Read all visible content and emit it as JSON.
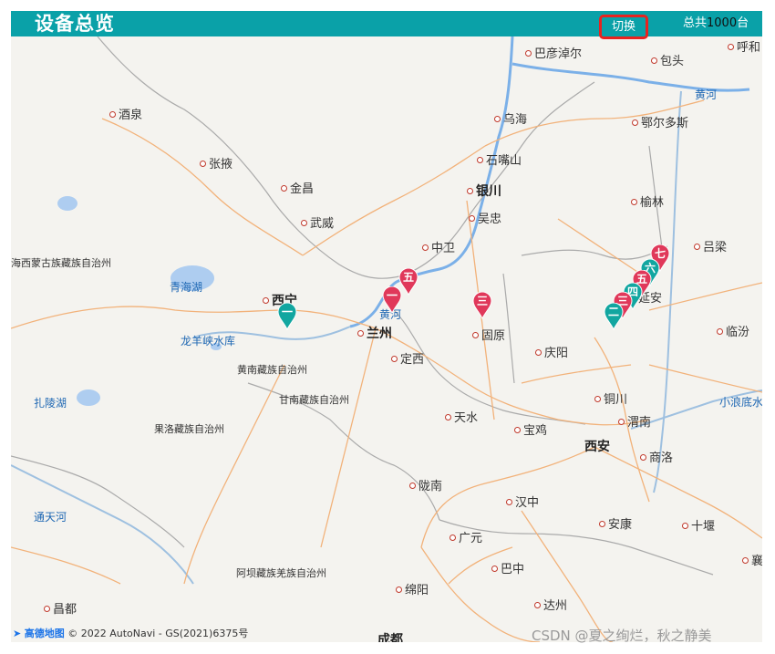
{
  "header": {
    "title": "设备总览",
    "switch_label": "切换",
    "total_prefix": "总共",
    "total_count": "1000",
    "total_suffix": "台"
  },
  "colors": {
    "header_bg": "#0aa1a8",
    "highlight_border": "#e8231f",
    "marker_red": "#e0385a",
    "marker_teal": "#12a6a0"
  },
  "cities": [
    "巴彦淖尔",
    "包头",
    "呼和",
    "酒泉",
    "乌海",
    "鄂尔多斯",
    "张掖",
    "石嘴山",
    "金昌",
    "银川",
    "榆林",
    "吴忠",
    "武威",
    "中卫",
    "吕梁",
    "西宁",
    "兰州",
    "固原",
    "庆阳",
    "临汾",
    "定西",
    "延安",
    "铜川",
    "天水",
    "宝鸡",
    "渭南",
    "西安",
    "商洛",
    "陇南",
    "汉中",
    "安康",
    "十堰",
    "广元",
    "巴中",
    "绵阳",
    "达州",
    "昌都",
    "成都",
    "襄"
  ],
  "regions": [
    "海西蒙古族藏族自治州",
    "黄南藏族自治州",
    "甘南藏族自治州",
    "果洛藏族自治州",
    "阿坝藏族羌族自治州"
  ],
  "water": [
    "黄河",
    "黄河",
    "青海湖",
    "龙羊峡水库",
    "扎陵湖",
    "通天河",
    "小浪底水"
  ],
  "markers": [
    {
      "label": "一",
      "color": "teal"
    },
    {
      "label": "五",
      "color": "red"
    },
    {
      "label": "一",
      "color": "red"
    },
    {
      "label": "三",
      "color": "red"
    },
    {
      "label": "七",
      "color": "red"
    },
    {
      "label": "六",
      "color": "teal"
    },
    {
      "label": "五",
      "color": "red"
    },
    {
      "label": "四",
      "color": "teal"
    },
    {
      "label": "三",
      "color": "red"
    },
    {
      "label": "二",
      "color": "teal"
    }
  ],
  "attribution": {
    "logo": "高德地图",
    "text": "© 2022 AutoNavi - GS(2021)6375号"
  },
  "watermark": "CSDN @夏之绚烂，秋之静美"
}
